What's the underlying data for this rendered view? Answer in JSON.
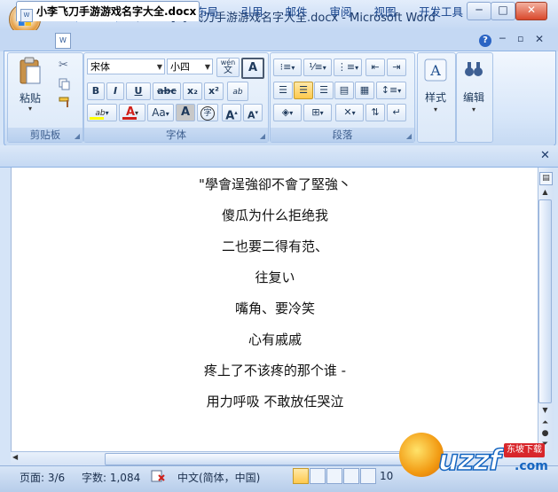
{
  "window": {
    "title": "小李飞刀手游游戏名字大全.docx - Microsoft Word",
    "minimize": "─",
    "maximize": "□",
    "close": "✕"
  },
  "tabs": [
    {
      "label": "开始",
      "active": true
    },
    {
      "label": "插入"
    },
    {
      "label": "页面布局"
    },
    {
      "label": "引用"
    },
    {
      "label": "邮件"
    },
    {
      "label": "审阅"
    },
    {
      "label": "视图"
    },
    {
      "label": "开发工具"
    }
  ],
  "ribbon": {
    "clipboard": {
      "paste_label": "粘贴",
      "group_label": "剪贴板"
    },
    "font": {
      "font_name": "宋体",
      "font_size": "小四",
      "wen": "wén",
      "wen_char": "文",
      "A_char": "A",
      "bold": "B",
      "italic": "I",
      "underline": "U",
      "strike": "abc",
      "subscript": "x₂",
      "superscript": "x²",
      "aa_label": "Aa",
      "grow_label": "A",
      "ab_label": "ab",
      "circle_char": "字",
      "group_label": "字体"
    },
    "paragraph": {
      "group_label": "段落"
    },
    "styles": {
      "label": "样式"
    },
    "editing": {
      "label": "编辑"
    }
  },
  "document": {
    "tab_title": "小李飞刀手游游戏名字大全.docx",
    "lines": [
      "\"學會逞強卻不會了堅強丶",
      "傻瓜为什么拒绝我",
      "二也要二得有范、",
      "往复い",
      "嘴角、要冷笑",
      "心有戚戚",
      "疼上了不该疼的那个谁 -",
      "用力呼吸 不敢放任哭泣"
    ]
  },
  "status": {
    "page": "页面: 3/6",
    "words": "字数: 1,084",
    "language": "中文(简体，中国)",
    "zoom": "10"
  },
  "watermark": {
    "text": "uzzf",
    "suffix": ".com",
    "tag": "东坡下载"
  },
  "colors": {
    "accent": "#15428b",
    "office_orange": "#e08d25",
    "watermark_red": "#d8262b"
  }
}
